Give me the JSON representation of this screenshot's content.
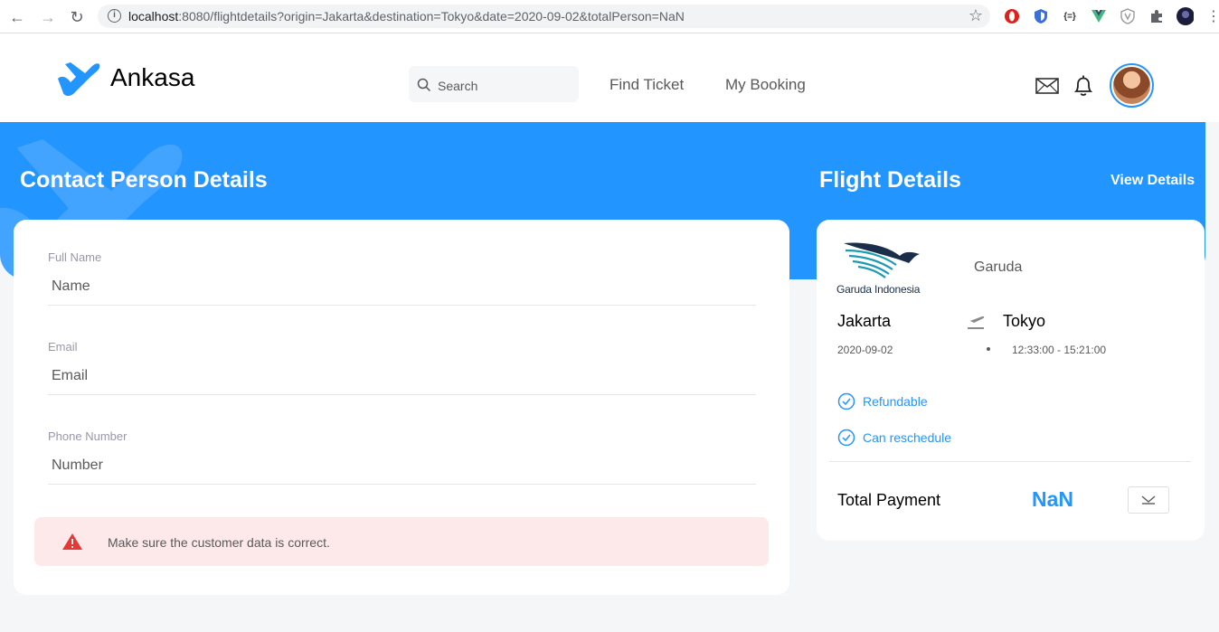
{
  "browser": {
    "url_prefix": "localhost",
    "url_rest": ":8080/flightdetails?origin=Jakarta&destination=Tokyo&date=2020-09-02&totalPerson=NaN"
  },
  "header": {
    "brand": "Ankasa",
    "search_placeholder": "Search",
    "nav": [
      "Find Ticket",
      "My Booking"
    ]
  },
  "contact": {
    "title": "Contact Person Details",
    "fields": [
      {
        "label": "Full Name",
        "placeholder": "Name"
      },
      {
        "label": "Email",
        "placeholder": "Email"
      },
      {
        "label": "Phone Number",
        "placeholder": "Number"
      }
    ],
    "warning": "Make sure the customer data is correct."
  },
  "flight": {
    "title": "Flight Details",
    "view_details": "View Details",
    "airline_logo_text": "Garuda Indonesia",
    "airline": "Garuda",
    "origin": "Jakarta",
    "destination": "Tokyo",
    "date": "2020-09-02",
    "time": "12:33:00 - 15:21:00",
    "features": [
      "Refundable",
      "Can reschedule"
    ],
    "total_label": "Total Payment",
    "total_value": "NaN"
  },
  "colors": {
    "primary": "#2395ff",
    "warning_bg": "#fde9e9",
    "warning_icon": "#e53935"
  }
}
